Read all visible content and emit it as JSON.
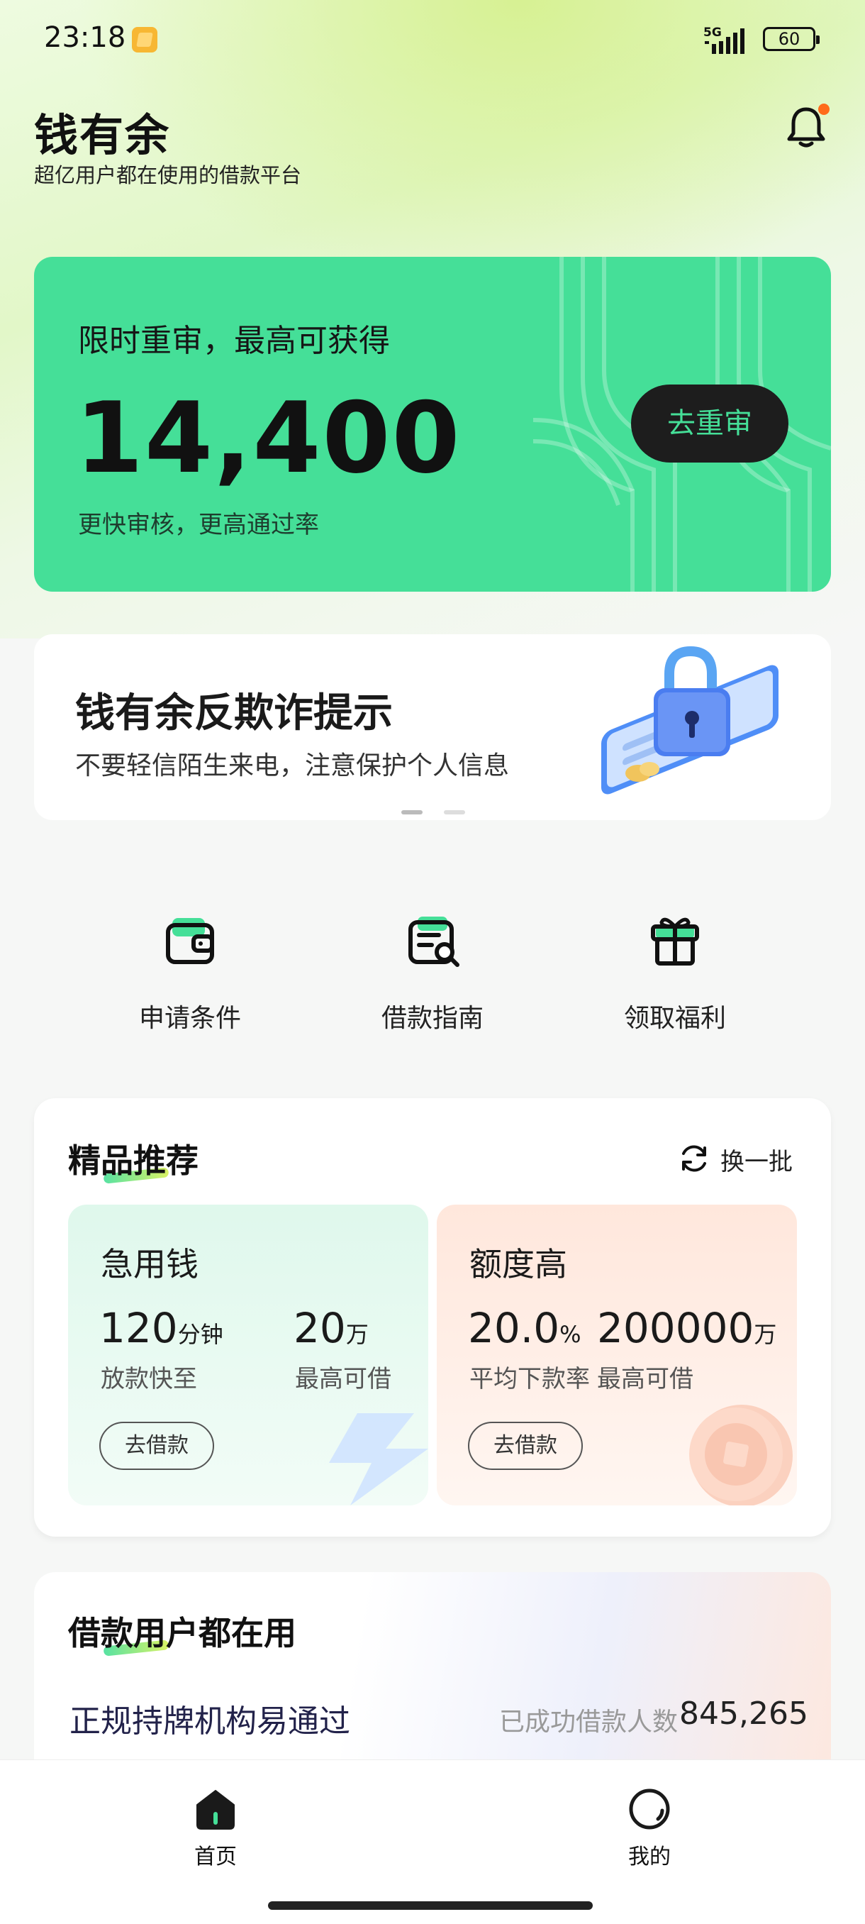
{
  "status_bar": {
    "time": "23:18",
    "network": "5G",
    "battery": "60"
  },
  "header": {
    "title": "钱有余",
    "subtitle": "超亿用户都在使用的借款平台",
    "bell_icon": "bell-icon",
    "notification_dot_color": "#ff6b1a"
  },
  "promo": {
    "headline": "限时重审，最高可获得",
    "amount": "14,400",
    "subtext": "更快审核，更高通过率",
    "button_label": "去重审",
    "accent_color": "#45df98"
  },
  "banner": {
    "title": "钱有余反欺诈提示",
    "text": "不要轻信陌生来电，注意保护个人信息",
    "illustration": "lock-phone-illustration",
    "active_index": 0,
    "slides": 2
  },
  "quick_entries": [
    {
      "label": "申请条件",
      "icon": "wallet-icon"
    },
    {
      "label": "借款指南",
      "icon": "document-search-icon"
    },
    {
      "label": "领取福利",
      "icon": "gift-icon"
    }
  ],
  "recommend": {
    "title": "精品推荐",
    "refresh_label": "换一批",
    "cards": [
      {
        "title": "急用钱",
        "stat1_value": "120",
        "stat1_unit": "分钟",
        "stat1_label": "放款快至",
        "stat2_value": "20",
        "stat2_unit": "万",
        "stat2_label": "最高可借",
        "button": "去借款"
      },
      {
        "title": "额度高",
        "stat1_value": "20.0",
        "stat1_unit": "%",
        "stat1_label": "平均下款率",
        "stat2_value": "200000",
        "stat2_unit": "万",
        "stat2_label": "最高可借",
        "button": "去借款"
      }
    ]
  },
  "users": {
    "title": "借款用户都在用",
    "subtitle": "正规持牌机构易通过",
    "count_label": "已成功借款人数",
    "count": "845,265"
  },
  "bottom_nav": [
    {
      "label": "首页",
      "icon": "home-icon",
      "active": true
    },
    {
      "label": "我的",
      "icon": "profile-icon",
      "active": false
    }
  ]
}
